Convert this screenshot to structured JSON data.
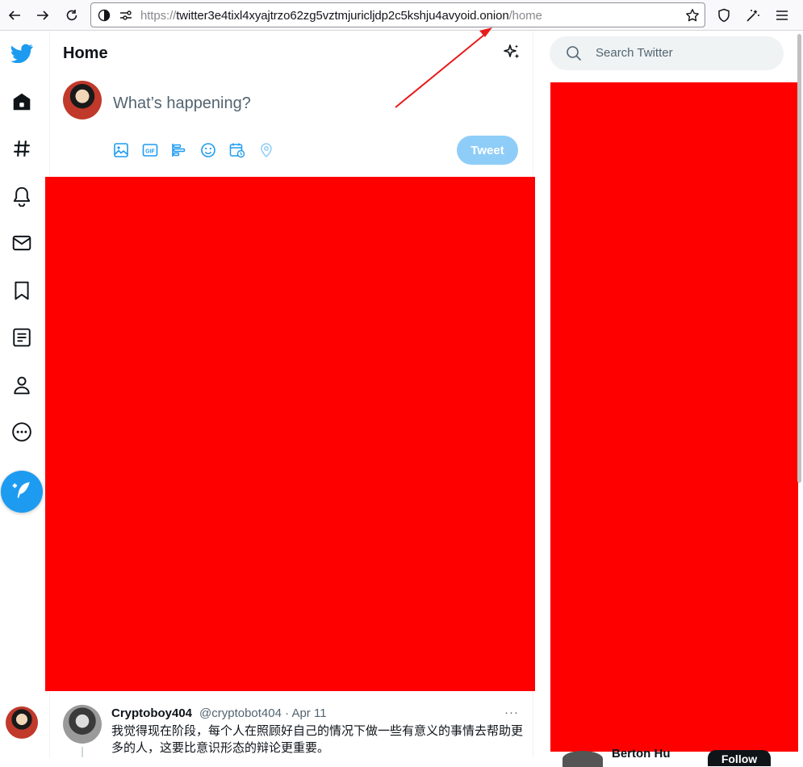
{
  "browser": {
    "url_scheme": "https://",
    "url_host": "twitter3e4tixl4xyajtrzo62zg5vztmjuricljdp2c5kshju4avyoid.onion",
    "url_path": "/home",
    "icons": [
      "back-icon",
      "forward-icon",
      "reload-icon",
      "site-info-icon",
      "permissions-icon",
      "bookmark-star-icon",
      "shield-icon",
      "extension-icon",
      "menu-icon"
    ]
  },
  "nav": {
    "items": [
      "twitter-logo-icon",
      "home-icon",
      "explore-hash-icon",
      "notifications-bell-icon",
      "messages-mail-icon",
      "bookmarks-icon",
      "lists-icon",
      "profile-icon",
      "more-icon"
    ],
    "compose": "compose-tweet-icon"
  },
  "main": {
    "title": "Home",
    "composer": {
      "placeholder": "What’s happening?",
      "tweet_label": "Tweet",
      "tools": [
        "media-icon",
        "gif-icon",
        "poll-icon",
        "emoji-icon",
        "schedule-icon",
        "location-icon"
      ]
    },
    "tweet": {
      "name": "Cryptoboy404",
      "handle": "@cryptobot404 · Apr 11",
      "more": "···",
      "text": "我觉得现在阶段，每个人在照顾好自己的情况下做一些有意义的事情去帮助更多的人，这要比意识形态的辩论更重要。"
    }
  },
  "sidebar": {
    "search_placeholder": "Search Twitter",
    "peek_name": "Berton Hu",
    "peek_follow": "Follow"
  },
  "colors": {
    "accent": "#1d9bf0",
    "redaction": "#ff0000",
    "tweet_button_disabled": "#8ecdf8"
  }
}
